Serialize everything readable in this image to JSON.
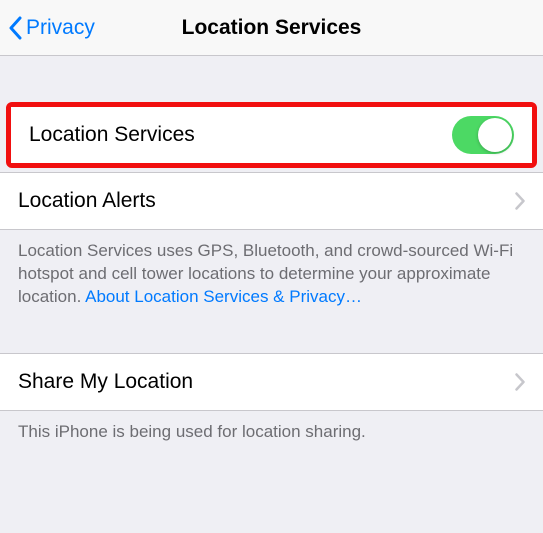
{
  "nav": {
    "back_label": "Privacy",
    "title": "Location Services"
  },
  "row_location_services": {
    "label": "Location Services",
    "toggle_on": true
  },
  "row_location_alerts": {
    "label": "Location Alerts"
  },
  "footer1": {
    "text": "Location Services uses GPS, Bluetooth, and crowd-sourced Wi-Fi hotspot and cell tower locations to determine your approximate location. ",
    "link": "About Location Services & Privacy…"
  },
  "row_share": {
    "label": "Share My Location"
  },
  "footer2": {
    "text": "This iPhone is being used for location sharing."
  },
  "colors": {
    "tint": "#007aff",
    "toggle_on": "#4cd964",
    "highlight": "#f10f0f"
  }
}
